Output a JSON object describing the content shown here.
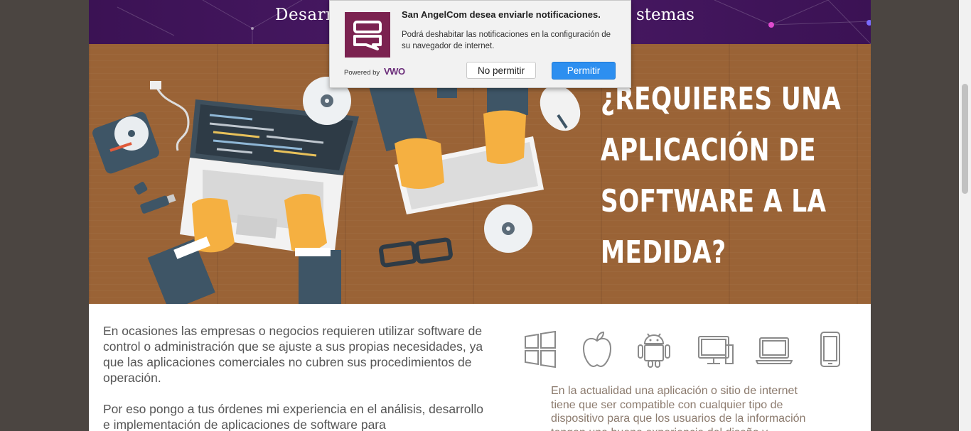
{
  "banner": {
    "title_left": "Desarr",
    "title_right": "stemas"
  },
  "hero": {
    "title_lines": [
      "¿REQUIERES UNA",
      "APLICACIÓN DE",
      "SOFTWARE A LA",
      "MEDIDA?"
    ]
  },
  "content": {
    "left_paragraphs": [
      "En ocasiones las empresas o negocios requieren utilizar software de control o administración que se ajuste a sus propias necesidades, ya que las aplicaciones comerciales no cubren sus procedimientos de operación.",
      "Por eso pongo a tus órdenes mi experiencia en el análisis, desarrollo e implementación de aplicaciones de software para"
    ],
    "right_paragraph": "En la actualidad una aplicación o sitio de internet tiene que ser compatible con cualquier tipo de dispositivo para que los usuarios de la información tengan una buena experiencia del diseño y",
    "device_icons": [
      "windows-icon",
      "apple-icon",
      "android-icon",
      "desktop-icon",
      "laptop-icon",
      "smartphone-icon"
    ]
  },
  "notification": {
    "title": "San AngelCom desea enviarle notificaciones.",
    "body": "Podrá deshabitar las notificaciones en la configuración de su navegador de internet.",
    "powered_by": "Powered by",
    "brand": "VWO",
    "deny_label": "No permitir",
    "allow_label": "Permitir"
  },
  "colors": {
    "accent": "#2d8ff0",
    "brand": "#7b2250",
    "banner": "#3b1254",
    "wood": "#9a6336"
  }
}
